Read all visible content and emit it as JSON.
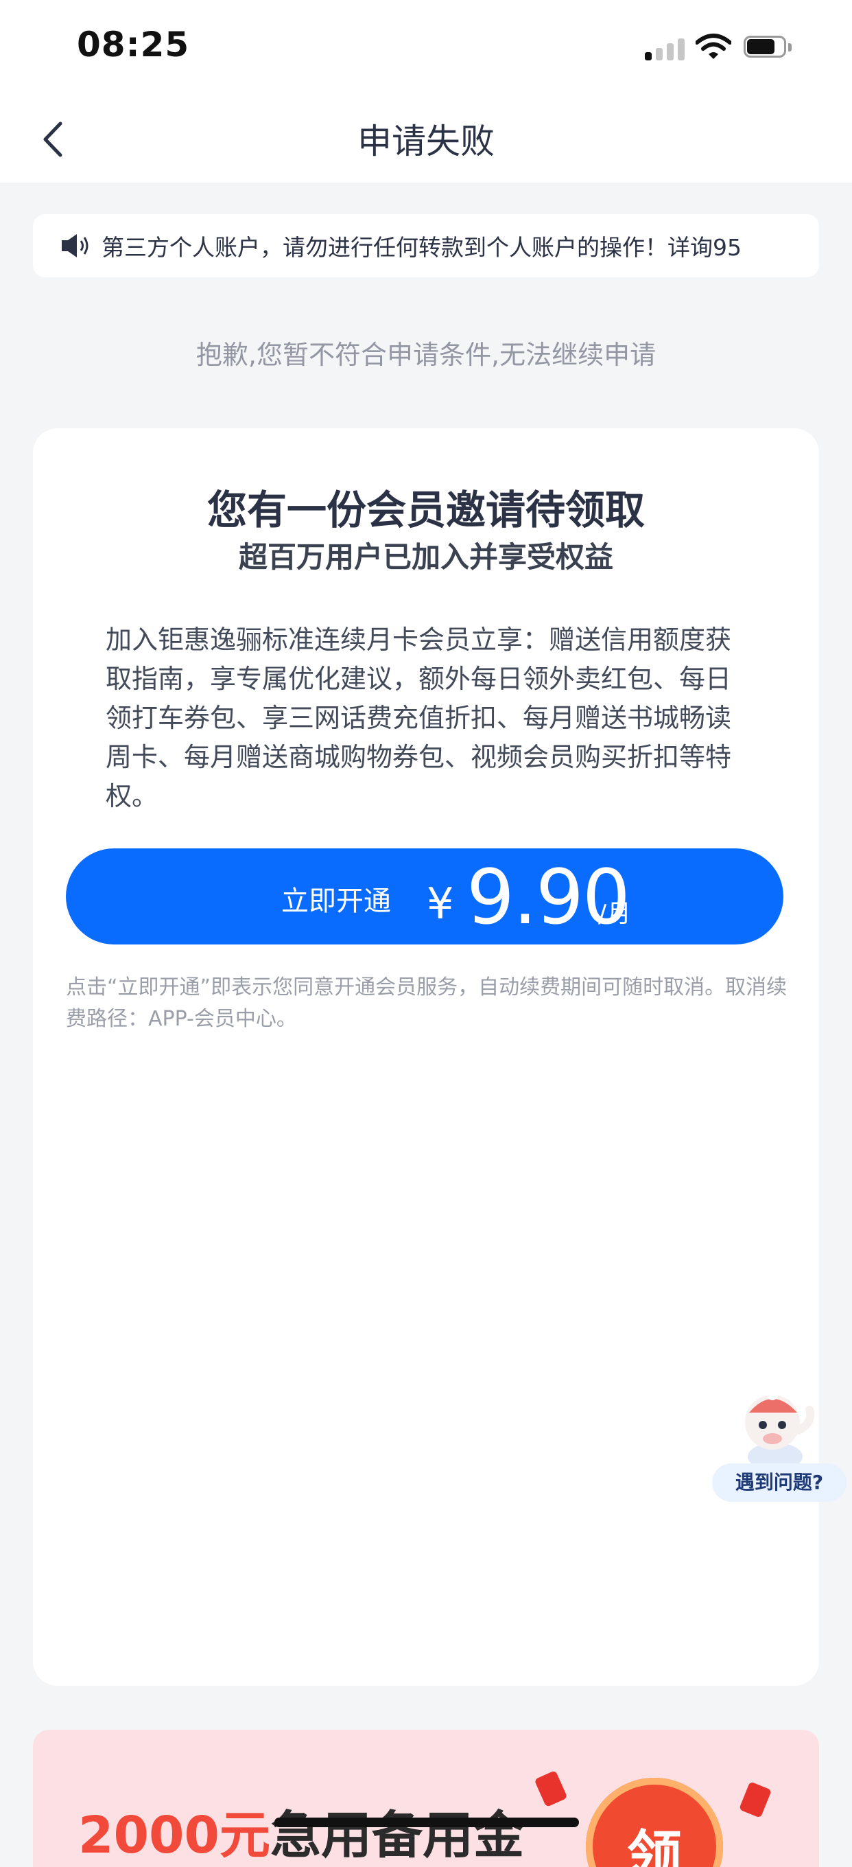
{
  "status_bar": {
    "time": "08:25"
  },
  "nav": {
    "title": "申请失败"
  },
  "notice": {
    "text": "第三方个人账户，请勿进行任何转款到个人账户的操作！详询95"
  },
  "result": {
    "message": "抱歉,您暂不符合申请条件,无法继续申请"
  },
  "membership_card": {
    "title": "您有一份会员邀请待领取",
    "subtitle": "超百万用户已加入并享受权益",
    "description": "加入钜惠逸骊标准连续月卡会员立享：赠送信用额度获取指南，享专属优化建议，额外每日领外卖红包、每日领打车券包、享三网话费充值折扣、每月赠送书城畅读周卡、每月赠送商城购物券包、视频会员购买折扣等特权。",
    "button": {
      "label": "立即开通",
      "currency": "¥",
      "price": "9.90",
      "unit": "/月"
    },
    "terms": "点击“立即开通”即表示您同意开通会员服务，自动续费期间可随时取消。取消续费路径：APP-会员中心。"
  },
  "help": {
    "label": "遇到问题?"
  },
  "promo": {
    "amount": "2000元",
    "rest": "急用备用金",
    "coin_text": "领"
  },
  "colors": {
    "accent": "#0a6cff",
    "promo_red": "#f1493a",
    "page_bg": "#f4f5f7"
  },
  "icons": [
    "chevron-left-icon",
    "speaker-icon",
    "signal-icon",
    "wifi-icon",
    "battery-icon",
    "mascot-icon"
  ]
}
